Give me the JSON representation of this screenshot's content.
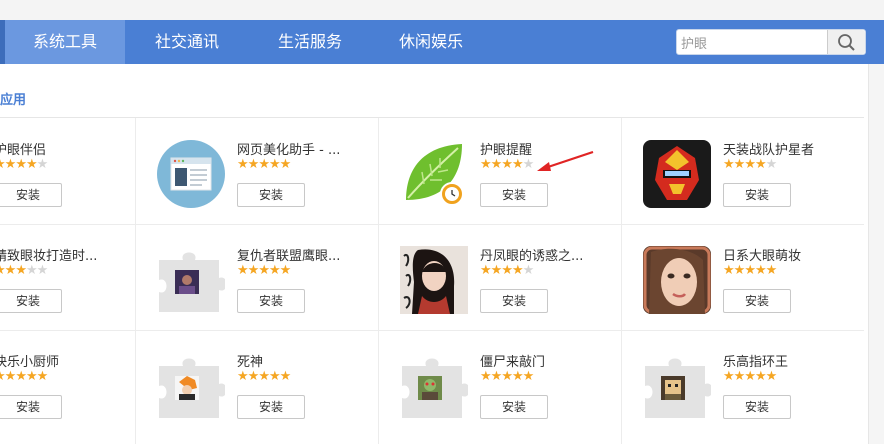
{
  "nav": {
    "tabs": [
      {
        "label": "系统工具",
        "active": true
      },
      {
        "label": "社交通讯",
        "active": false
      },
      {
        "label": "生活服务",
        "active": false
      },
      {
        "label": "休闲娱乐",
        "active": false
      }
    ],
    "search_value": "护眼"
  },
  "section_title": "应用",
  "install_label": "安装",
  "rows": [
    [
      {
        "name": "护眼伴侣",
        "rating": 4,
        "icon": "app-icon"
      },
      {
        "name": "网页美化助手 - ...",
        "rating": 5,
        "icon": "webpage-icon"
      },
      {
        "name": "护眼提醒",
        "rating": 4,
        "icon": "leaf-clock-icon"
      },
      {
        "name": "天装战队护星者",
        "rating": 4,
        "icon": "red-mask-hero-icon"
      }
    ],
    [
      {
        "name": "精致眼妆打造时...",
        "rating": 3,
        "icon": "app-icon"
      },
      {
        "name": "复仇者联盟鹰眼...",
        "rating": 5,
        "icon": "puzzle-icon"
      },
      {
        "name": "丹凤眼的诱惑之...",
        "rating": 4,
        "icon": "portrait-girl-icon"
      },
      {
        "name": "日系大眼萌妆",
        "rating": 5,
        "icon": "face-photo-icon"
      }
    ],
    [
      {
        "name": "快乐小厨师",
        "rating": 5,
        "icon": "app-icon"
      },
      {
        "name": "死神",
        "rating": 5,
        "icon": "puzzle-icon"
      },
      {
        "name": "僵尸来敲门",
        "rating": 5,
        "icon": "puzzle-icon"
      },
      {
        "name": "乐高指环王",
        "rating": 5,
        "icon": "puzzle-icon"
      }
    ]
  ],
  "colors": {
    "nav": "#4a7fd4",
    "active_tab": "#6b98e0",
    "star": "#f5a623",
    "arrow": "#e02424"
  }
}
